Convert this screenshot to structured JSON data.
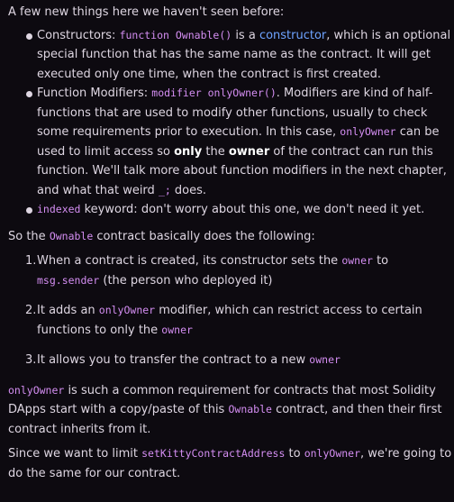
{
  "intro": "A few new things here we haven't seen before:",
  "bullets": {
    "b1": {
      "lead": "Constructors: ",
      "code": "function Ownable()",
      "mid": " is a ",
      "link": "constructor",
      "rest": ", which is an optional special function that has the same name as the contract. It will get executed only one time, when the contract is first created."
    },
    "b2": {
      "lead": "Function Modifiers: ",
      "code": "modifier onlyOwner()",
      "t1": ". Modifiers are kind of half-functions that are used to modify other functions, usually to check some requirements prior to execution. In this case, ",
      "code2": "onlyOwner",
      "t2": " can be used to limit access so ",
      "bold1": "only",
      "t3": " the ",
      "bold2": "owner",
      "t4": " of the contract can run this function. We'll talk more about function modifiers in the next chapter, and what that weird ",
      "code3": "_;",
      "t5": " does."
    },
    "b3": {
      "code": "indexed",
      "rest": " keyword: don't worry about this one, we don't need it yet."
    }
  },
  "summary": {
    "pre": "So the ",
    "code": "Ownable",
    "post": " contract basically does the following:"
  },
  "steps": {
    "s1": {
      "num": "1.",
      "t1": "When a contract is created, its constructor sets the ",
      "code1": "owner",
      "t2": " to ",
      "code2": "msg.sender",
      "t3": " (the person who deployed it)"
    },
    "s2": {
      "num": "2.",
      "t1": "It adds an ",
      "code1": "onlyOwner",
      "t2": " modifier, which can restrict access to certain functions to only the ",
      "code2": "owner"
    },
    "s3": {
      "num": "3.",
      "t1": "It allows you to transfer the contract to a new ",
      "code1": "owner"
    }
  },
  "para1": {
    "code1": "onlyOwner",
    "t1": " is such a common requirement for contracts that most Solidity DApps start with a copy/paste of this ",
    "code2": "Ownable",
    "t2": " contract, and then their first contract inherits from it."
  },
  "para2": {
    "t1": "Since we want to limit ",
    "code1": "setKittyContractAddress",
    "t2": " to ",
    "code2": "onlyOwner",
    "t3": ", we're going to do the same for our contract."
  }
}
